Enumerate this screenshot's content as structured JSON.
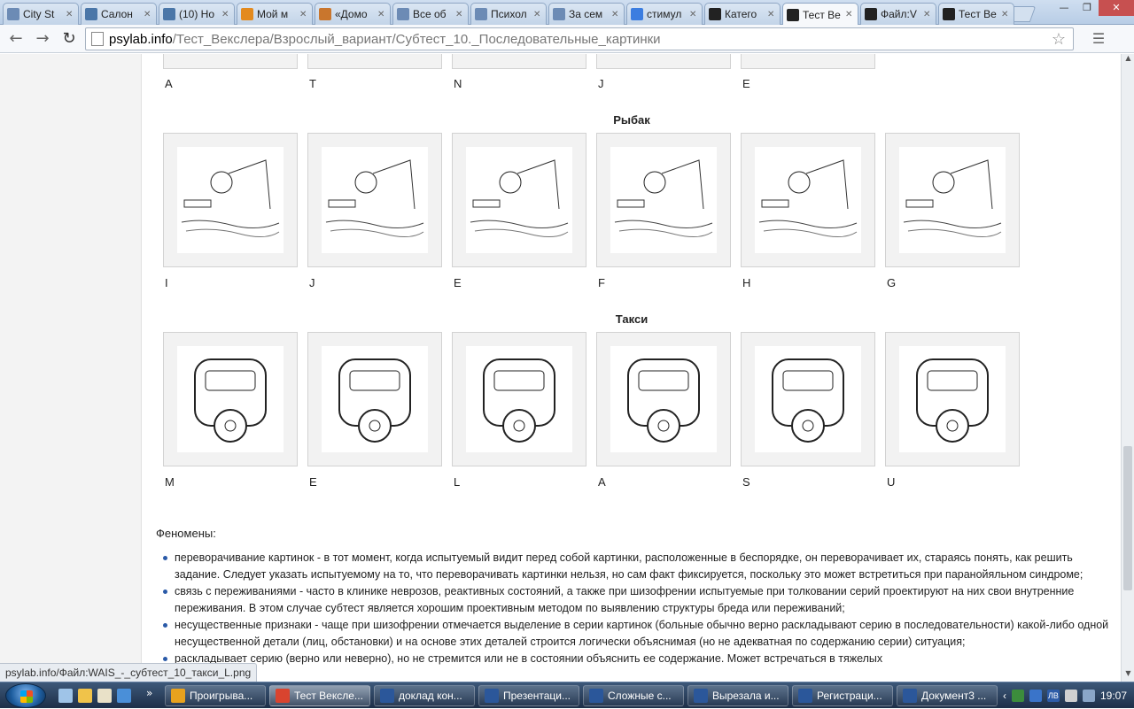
{
  "browser": {
    "tabs": [
      {
        "title": "City St",
        "favicon": "doc-icon",
        "color": "#6c8bb5"
      },
      {
        "title": "Салон",
        "favicon": "vk-icon",
        "color": "#4a76a8"
      },
      {
        "title": "(10) Но",
        "favicon": "vk-icon",
        "color": "#4a76a8"
      },
      {
        "title": "Мой м",
        "favicon": "mailru-icon",
        "color": "#e38a1e"
      },
      {
        "title": "«Домо",
        "favicon": "pencil-icon",
        "color": "#c9762d"
      },
      {
        "title": "Все об",
        "favicon": "doc-icon",
        "color": "#6c8bb5"
      },
      {
        "title": "Психол",
        "favicon": "doc-icon",
        "color": "#6c8bb5"
      },
      {
        "title": "За сем",
        "favicon": "doc-icon",
        "color": "#6c8bb5"
      },
      {
        "title": "стимул",
        "favicon": "google-icon",
        "color": "#3b7de0"
      },
      {
        "title": "Катего",
        "favicon": "psylab-icon",
        "color": "#222"
      },
      {
        "title": "Тест Ве",
        "favicon": "psylab-icon",
        "color": "#222",
        "active": true
      },
      {
        "title": "Файл:V",
        "favicon": "psylab-icon",
        "color": "#222"
      },
      {
        "title": "Тест Ве",
        "favicon": "psylab-icon",
        "color": "#222"
      }
    ],
    "url_host": "psylab.info",
    "url_path": "/Тест_Векслера/Взрослый_вариант/Субтест_10._Последовательные_картинки",
    "status_url": "psylab.info/Файл:WAIS_-_субтест_10_такси_L.png"
  },
  "page": {
    "top_labels": [
      "A",
      "T",
      "N",
      "J",
      "E"
    ],
    "sections": [
      {
        "title": "Рыбак",
        "labels": [
          "I",
          "J",
          "E",
          "F",
          "H",
          "G"
        ]
      },
      {
        "title": "Такси",
        "labels": [
          "M",
          "E",
          "L",
          "A",
          "S",
          "U"
        ]
      }
    ],
    "phenomena_title": "Феномены:",
    "phenomena": [
      "переворачивание картинок - в тот момент, когда испытуемый видит перед собой картинки, расположенные в беспорядке, он переворачивает их, стараясь понять, как решить задание. Следует указать испытуемому на то, что переворачивать картинки нельзя, но сам факт фиксируется, поскольку это может встретиться при паранойяльном синдроме;",
      "связь с переживаниями - часто в клинике неврозов, реактивных состояний, а также при шизофрении испытуемые при толковании серий проектируют на них свои внутренние переживания. В этом случае субтест является хорошим проективным методом по выявлению структуры бреда или переживаний;",
      "несущественные признаки - чаще при шизофрении отмечается выделение в серии картинок (больные обычно верно раскладывают серию в последовательности) какой-либо одной несущественной детали (лиц, обстановки) и на основе этих деталей строится логически объяснимая (но не адекватная по содержанию серии) ситуация;",
      "раскладывает серию (верно или неверно), но не стремится или не в состоянии объяснить ее содержание. Может встречаться в тяжелых"
    ]
  },
  "taskbar": {
    "buttons": [
      {
        "label": "Проигрыва...",
        "color": "#e8a21e"
      },
      {
        "label": "Тест Вексле...",
        "color": "#d9442f",
        "active": true
      },
      {
        "label": "доклад кон...",
        "color": "#2b579a"
      },
      {
        "label": "Презентаци...",
        "color": "#2b579a"
      },
      {
        "label": "Сложные с...",
        "color": "#2b579a"
      },
      {
        "label": "Вырезала и...",
        "color": "#2b579a"
      },
      {
        "label": "Регистраци...",
        "color": "#2b579a"
      },
      {
        "label": "Документ3 ...",
        "color": "#2b579a"
      }
    ],
    "tray_lang": "ЛВ",
    "clock": "19:07"
  }
}
